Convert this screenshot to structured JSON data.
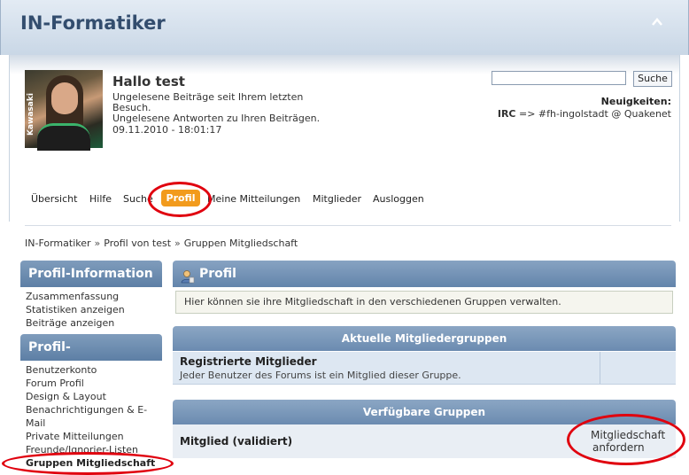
{
  "site": {
    "title": "IN-Formatiker"
  },
  "user": {
    "greeting": "Hallo test",
    "unread_posts": "Ungelesene Beiträge seit Ihrem letzten Besuch.",
    "unread_replies": "Ungelesene Antworten zu Ihren Beiträgen.",
    "datetime": "09.11.2010 - 18:01:17",
    "avatar_text": "Kawasaki"
  },
  "search": {
    "placeholder": "",
    "button": "Suche"
  },
  "news": {
    "heading": "Neuigkeiten:",
    "label": "IRC",
    "text": "=> #fh-ingolstadt @ Quakenet"
  },
  "menu": {
    "items": [
      "Übersicht",
      "Hilfe",
      "Suche",
      "Profil",
      "Meine Mitteilungen",
      "Mitglieder",
      "Ausloggen"
    ],
    "active": "Profil"
  },
  "breadcrumb": [
    "IN-Formatiker",
    "Profil von test",
    "Gruppen Mitgliedschaft"
  ],
  "breadcrumb_sep": "»",
  "sidebar": {
    "info_title": "Profil-Information",
    "info_items": [
      "Zusammenfassung",
      "Statistiken anzeigen",
      "Beiträge anzeigen"
    ],
    "settings_title": "Profil-Einstellungen",
    "settings_items": [
      "Benutzerkonto",
      "Forum Profil",
      "Design & Layout",
      "Benachrichtigungen & E-Mail",
      "Private Mitteilungen",
      "Freunde/Ignorier-Listen",
      "Gruppen Mitgliedschaft"
    ]
  },
  "main": {
    "title": "Profil",
    "description": "Hier können sie ihre Mitgliedschaft in den verschiedenen Gruppen verwalten.",
    "current_groups_title": "Aktuelle Mitgliedergruppen",
    "current_group": {
      "name": "Registrierte Mitglieder",
      "desc": "Jeder Benutzer des Forums ist ein Mitglied dieser Gruppe."
    },
    "available_groups_title": "Verfügbare Gruppen",
    "available_group": {
      "name": "Mitglied (validiert)",
      "action_line1": "Mitgliedschaft",
      "action_line2": "anfordern"
    }
  },
  "colors": {
    "accent": "#f29b1d",
    "header": "#6385ab",
    "highlight_ring": "#e0000e"
  }
}
